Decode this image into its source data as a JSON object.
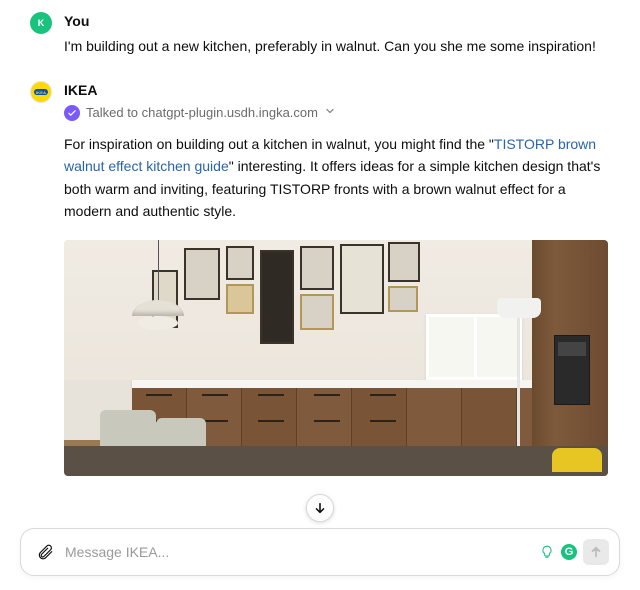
{
  "user_message": {
    "author": "You",
    "text": "I'm building out a new kitchen, preferably in walnut. Can you she me some inspiration!",
    "avatar_letter": "K"
  },
  "assistant_message": {
    "author": "IKEA",
    "plugin_notice": "Talked to chatgpt-plugin.usdh.ingka.com",
    "body_before_link": "For inspiration on building out a kitchen in walnut, you might find the \"",
    "link_text": "TISTORP brown walnut effect kitchen guide",
    "body_after_link": "\" interesting. It offers ideas for a simple kitchen design that's both warm and inviting, featuring TISTORP fronts with a brown walnut effect for a modern and authentic style."
  },
  "composer": {
    "placeholder": "Message IKEA..."
  },
  "icons": {
    "check": "check-icon",
    "chevron_down": "chevron-down-icon",
    "attach": "paperclip-icon",
    "send": "arrow-up-icon",
    "scroll": "arrow-down-icon"
  },
  "colors": {
    "link": "#2964aa",
    "accent_green": "#19c37d",
    "badge_purple": "#7a5af8"
  }
}
